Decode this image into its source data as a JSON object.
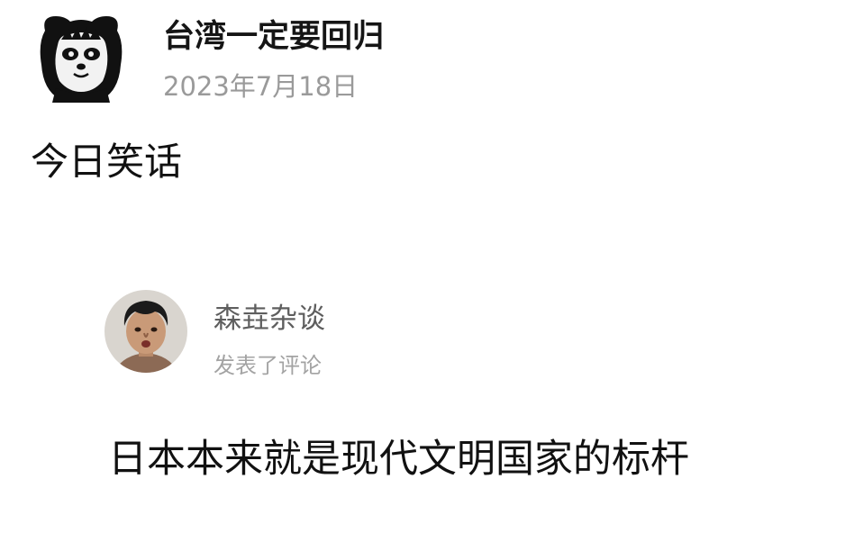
{
  "post": {
    "author": "台湾一定要回归",
    "date": "2023年7月18日",
    "text": "今日笑话",
    "avatar_icon": "panda-avatar-icon"
  },
  "comment": {
    "author": "森垚杂谈",
    "action": "发表了评论",
    "text": "日本本来就是现代文明国家的标杆",
    "avatar_icon": "person-avatar-icon"
  }
}
